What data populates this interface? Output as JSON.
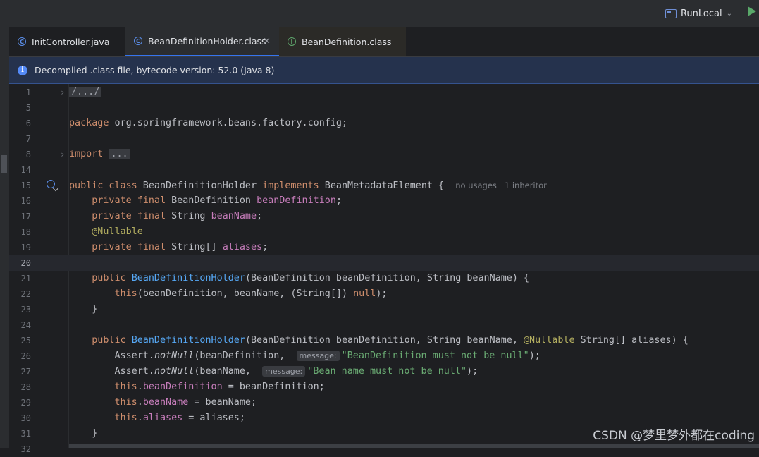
{
  "toolbar": {
    "run_config_label": "RunLocal"
  },
  "tabs": [
    {
      "label": "InitController.java",
      "icon": "class-icon"
    },
    {
      "label": "BeanDefinitionHolder.class",
      "icon": "class-icon",
      "close": "×"
    },
    {
      "label": "BeanDefinition.class",
      "icon": "interface-icon"
    }
  ],
  "banner": {
    "text": "Decompiled .class file, bytecode version: 52.0 (Java 8)"
  },
  "editor": {
    "lines": [
      {
        "num": "1",
        "tokens": [
          {
            "t": "/.../",
            "c": "fold-box"
          }
        ]
      },
      {
        "num": "5",
        "tokens": []
      },
      {
        "num": "6",
        "tokens": [
          {
            "t": "package",
            "c": "kw"
          },
          {
            "t": " org.springframework.beans.factory.config;",
            "c": ""
          }
        ]
      },
      {
        "num": "7",
        "tokens": []
      },
      {
        "num": "8",
        "tokens": [
          {
            "t": "import",
            "c": "kw"
          },
          {
            "t": " ",
            "c": ""
          },
          {
            "t": "...",
            "c": "fold-box"
          }
        ]
      },
      {
        "num": "14",
        "tokens": []
      },
      {
        "num": "15",
        "tokens": [
          {
            "t": "public class",
            "c": "kw"
          },
          {
            "t": " BeanDefinitionHolder ",
            "c": ""
          },
          {
            "t": "implements",
            "c": "kw"
          },
          {
            "t": " BeanMetadataElement {  ",
            "c": ""
          },
          {
            "t": "no usages   1 inheritor",
            "c": "hint"
          }
        ]
      },
      {
        "num": "16",
        "tokens": [
          {
            "t": "    ",
            "c": ""
          },
          {
            "t": "private final",
            "c": "kw"
          },
          {
            "t": " BeanDefinition ",
            "c": ""
          },
          {
            "t": "beanDefinition",
            "c": "fld"
          },
          {
            "t": ";",
            "c": ""
          }
        ]
      },
      {
        "num": "17",
        "tokens": [
          {
            "t": "    ",
            "c": ""
          },
          {
            "t": "private final",
            "c": "kw"
          },
          {
            "t": " String ",
            "c": ""
          },
          {
            "t": "beanName",
            "c": "fld"
          },
          {
            "t": ";",
            "c": ""
          }
        ]
      },
      {
        "num": "18",
        "tokens": [
          {
            "t": "    ",
            "c": ""
          },
          {
            "t": "@Nullable",
            "c": "ann"
          }
        ]
      },
      {
        "num": "19",
        "tokens": [
          {
            "t": "    ",
            "c": ""
          },
          {
            "t": "private final",
            "c": "kw"
          },
          {
            "t": " String[] ",
            "c": ""
          },
          {
            "t": "aliases",
            "c": "fld"
          },
          {
            "t": ";",
            "c": ""
          }
        ]
      },
      {
        "num": "20",
        "tokens": [],
        "current": true
      },
      {
        "num": "21",
        "tokens": [
          {
            "t": "    ",
            "c": ""
          },
          {
            "t": "public",
            "c": "kw"
          },
          {
            "t": " ",
            "c": ""
          },
          {
            "t": "BeanDefinitionHolder",
            "c": "fn"
          },
          {
            "t": "(BeanDefinition beanDefinition, String beanName) {",
            "c": ""
          }
        ]
      },
      {
        "num": "22",
        "tokens": [
          {
            "t": "        ",
            "c": ""
          },
          {
            "t": "this",
            "c": "kw"
          },
          {
            "t": "(beanDefinition, beanName, (String[]) ",
            "c": ""
          },
          {
            "t": "null",
            "c": "kw"
          },
          {
            "t": ");",
            "c": ""
          }
        ]
      },
      {
        "num": "23",
        "tokens": [
          {
            "t": "    }",
            "c": ""
          }
        ]
      },
      {
        "num": "24",
        "tokens": []
      },
      {
        "num": "25",
        "tokens": [
          {
            "t": "    ",
            "c": ""
          },
          {
            "t": "public",
            "c": "kw"
          },
          {
            "t": " ",
            "c": ""
          },
          {
            "t": "BeanDefinitionHolder",
            "c": "fn"
          },
          {
            "t": "(BeanDefinition beanDefinition, String beanName, ",
            "c": ""
          },
          {
            "t": "@Nullable",
            "c": "ann"
          },
          {
            "t": " String[] aliases) {",
            "c": ""
          }
        ]
      },
      {
        "num": "26",
        "tokens": [
          {
            "t": "        Assert.",
            "c": ""
          },
          {
            "t": "notNull",
            "c": "it"
          },
          {
            "t": "(beanDefinition,  ",
            "c": ""
          },
          {
            "t": "message:",
            "c": "param-hint"
          },
          {
            "t": "\"BeanDefinition must not be null\"",
            "c": "str"
          },
          {
            "t": ");",
            "c": ""
          }
        ]
      },
      {
        "num": "27",
        "tokens": [
          {
            "t": "        Assert.",
            "c": ""
          },
          {
            "t": "notNull",
            "c": "it"
          },
          {
            "t": "(beanName,  ",
            "c": ""
          },
          {
            "t": "message:",
            "c": "param-hint"
          },
          {
            "t": "\"Bean name must not be null\"",
            "c": "str"
          },
          {
            "t": ");",
            "c": ""
          }
        ]
      },
      {
        "num": "28",
        "tokens": [
          {
            "t": "        ",
            "c": ""
          },
          {
            "t": "this",
            "c": "kw"
          },
          {
            "t": ".",
            "c": ""
          },
          {
            "t": "beanDefinition",
            "c": "fld"
          },
          {
            "t": " = beanDefinition;",
            "c": ""
          }
        ]
      },
      {
        "num": "29",
        "tokens": [
          {
            "t": "        ",
            "c": ""
          },
          {
            "t": "this",
            "c": "kw"
          },
          {
            "t": ".",
            "c": ""
          },
          {
            "t": "beanName",
            "c": "fld"
          },
          {
            "t": " = beanName;",
            "c": ""
          }
        ]
      },
      {
        "num": "30",
        "tokens": [
          {
            "t": "        ",
            "c": ""
          },
          {
            "t": "this",
            "c": "kw"
          },
          {
            "t": ".",
            "c": ""
          },
          {
            "t": "aliases",
            "c": "fld"
          },
          {
            "t": " = aliases;",
            "c": ""
          }
        ]
      },
      {
        "num": "31",
        "tokens": [
          {
            "t": "    }",
            "c": ""
          }
        ]
      },
      {
        "num": "32",
        "tokens": []
      }
    ]
  },
  "watermark": "CSDN @梦里梦外都在coding"
}
